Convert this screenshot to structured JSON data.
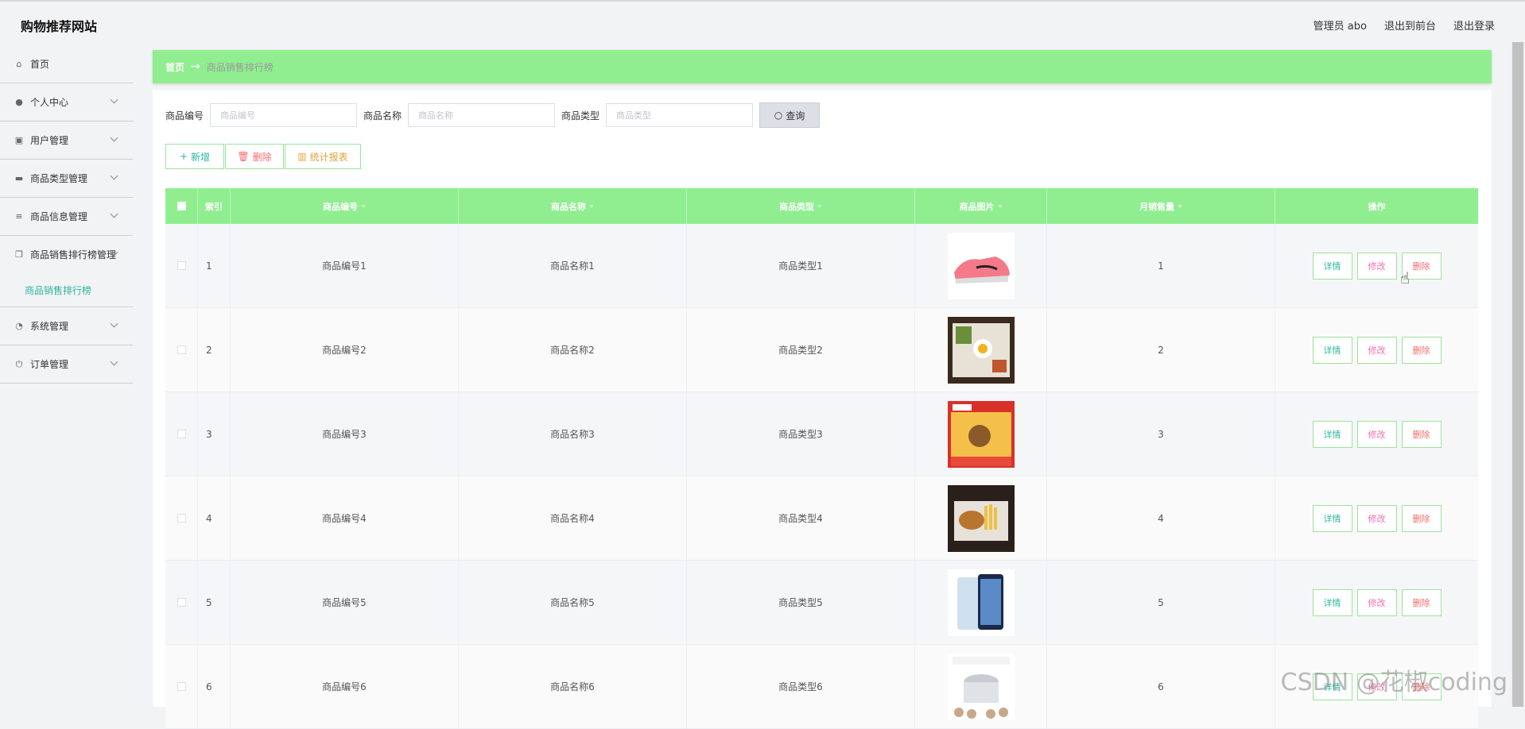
{
  "header": {
    "site_title": "购物推荐网站",
    "admin_label": "管理员 abo",
    "to_frontend": "退出到前台",
    "logout": "退出登录"
  },
  "sidebar": {
    "items": [
      {
        "label": "首页",
        "icon": "home-icon",
        "has_chevron": false
      },
      {
        "label": "个人中心",
        "icon": "user-icon",
        "has_chevron": true
      },
      {
        "label": "用户管理",
        "icon": "clipboard-icon",
        "has_chevron": true
      },
      {
        "label": "商品类型管理",
        "icon": "briefcase-icon",
        "has_chevron": true
      },
      {
        "label": "商品信息管理",
        "icon": "list-icon",
        "has_chevron": true
      },
      {
        "label": "商品销售排行榜管理",
        "icon": "copy-icon",
        "has_chevron": true
      }
    ],
    "active_sub": "商品销售排行榜",
    "items_after": [
      {
        "label": "系统管理",
        "icon": "gauge-icon",
        "has_chevron": true
      },
      {
        "label": "订单管理",
        "icon": "power-icon",
        "has_chevron": true
      }
    ]
  },
  "breadcrumb": {
    "home": "首页",
    "arrow": "→",
    "current": "商品销售排行榜"
  },
  "search": {
    "fields": [
      {
        "label": "商品编号",
        "placeholder": "商品编号"
      },
      {
        "label": "商品名称",
        "placeholder": "商品名称"
      },
      {
        "label": "商品类型",
        "placeholder": "商品类型"
      }
    ],
    "query_label": "查询"
  },
  "actions": {
    "add": "新增",
    "delete": "删除",
    "stats": "统计报表"
  },
  "table": {
    "headers": [
      "索引",
      "商品编号",
      "商品名称",
      "商品类型",
      "商品图片",
      "月销售量",
      "操作"
    ],
    "op_labels": {
      "detail": "详情",
      "edit": "修改",
      "delete": "删除"
    },
    "rows": [
      {
        "index": "1",
        "code": "商品编号1",
        "name": "商品名称1",
        "type": "商品类型1",
        "image": "sneaker",
        "sales": "1"
      },
      {
        "index": "2",
        "code": "商品编号2",
        "name": "商品名称2",
        "type": "商品类型2",
        "image": "bento",
        "sales": "2"
      },
      {
        "index": "3",
        "code": "商品编号3",
        "name": "商品名称3",
        "type": "商品类型3",
        "image": "snack-box",
        "sales": "3"
      },
      {
        "index": "4",
        "code": "商品编号4",
        "name": "商品名称4",
        "type": "商品类型4",
        "image": "burger-fries",
        "sales": "4"
      },
      {
        "index": "5",
        "code": "商品编号5",
        "name": "商品名称5",
        "type": "商品类型5",
        "image": "smartphone",
        "sales": "5"
      },
      {
        "index": "6",
        "code": "商品编号6",
        "name": "商品名称6",
        "type": "商品类型6",
        "image": "rice-cooker",
        "sales": "6"
      }
    ]
  },
  "watermark": "CSDN @花椒coding",
  "colors": {
    "accent_green": "#90ee90",
    "teal": "#2bb5a0",
    "danger": "#f56c6c",
    "warning": "#e6a23c"
  }
}
